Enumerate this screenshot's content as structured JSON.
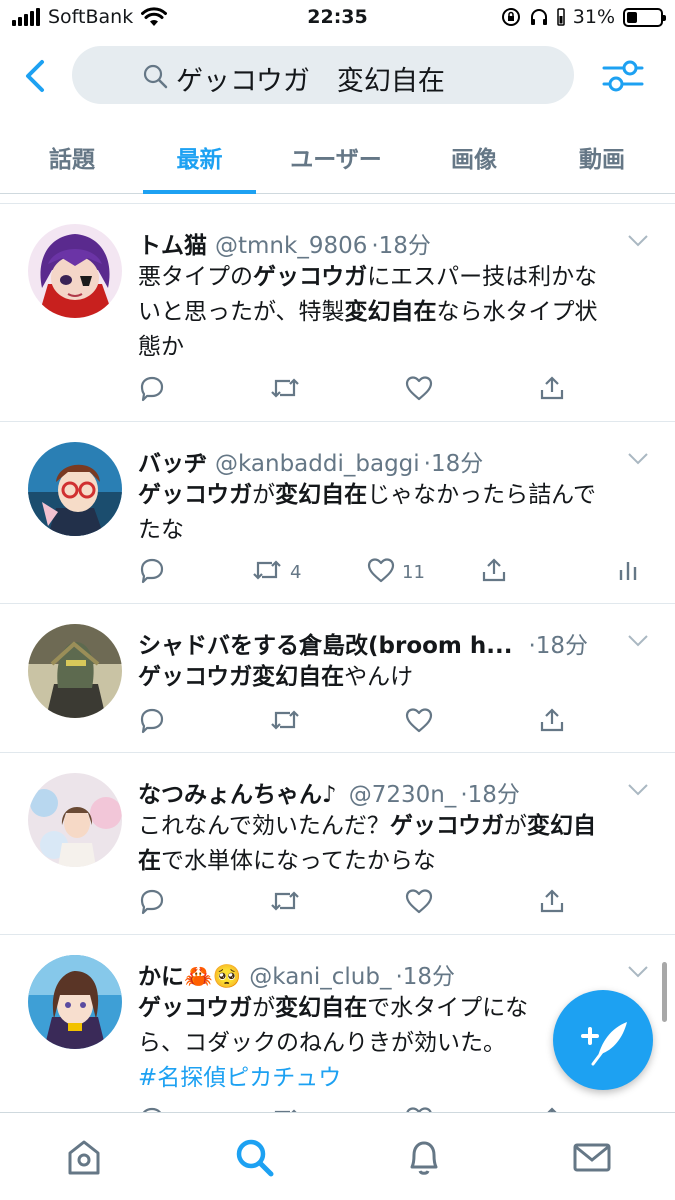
{
  "status_bar": {
    "carrier": "SoftBank",
    "time": "22:35",
    "battery": "31%"
  },
  "search": {
    "query": "ゲッコウガ　変幻自在"
  },
  "tabs": [
    {
      "label": "話題",
      "active": false
    },
    {
      "label": "最新",
      "active": true
    },
    {
      "label": "ユーザー",
      "active": false
    },
    {
      "label": "画像",
      "active": false
    },
    {
      "label": "動画",
      "active": false
    }
  ],
  "tweets": [
    {
      "name": "トム猫",
      "handle": "@tmnk_9806",
      "time": "·18分",
      "lines": [
        [
          {
            "t": "悪タイプの"
          },
          {
            "t": "ゲッコウガ",
            "b": true
          },
          {
            "t": "にエスパー技は利かな"
          }
        ],
        [
          {
            "t": "いと思ったが、特製"
          },
          {
            "t": "変幻自在",
            "b": true
          },
          {
            "t": "なら水タイプ状"
          }
        ],
        [
          {
            "t": "態か"
          }
        ]
      ],
      "retweets": "",
      "likes": ""
    },
    {
      "name": "バッヂ",
      "handle": "@kanbaddi_baggi",
      "time": "·18分",
      "lines": [
        [
          {
            "t": "ゲッコウガ",
            "b": true
          },
          {
            "t": "が"
          },
          {
            "t": "変幻自在",
            "b": true
          },
          {
            "t": "じゃなかったら詰んで"
          }
        ],
        [
          {
            "t": "たな"
          }
        ]
      ],
      "retweets": "4",
      "likes": "11"
    },
    {
      "name": "シャドバをする倉島改(broom h...",
      "handle": "",
      "time": "·18分",
      "lines": [
        [
          {
            "t": "ゲッコウガ変幻自在",
            "b": true
          },
          {
            "t": "やんけ"
          }
        ]
      ],
      "retweets": "",
      "likes": ""
    },
    {
      "name": "なつみょんちゃん♪",
      "handle": "@7230n_",
      "time": "·18分",
      "lines": [
        [
          {
            "t": "これなんで効いたんだ？"
          },
          {
            "t": "ゲッコウガ",
            "b": true
          },
          {
            "t": "が"
          },
          {
            "t": "変幻自",
            "b": true
          }
        ],
        [
          {
            "t": "在",
            "b": true
          },
          {
            "t": "で水単体になってたからな"
          }
        ]
      ],
      "retweets": "",
      "likes": ""
    },
    {
      "name": "かに🦀🥺",
      "handle": "@kani_club_",
      "time": "·18分",
      "lines": [
        [
          {
            "t": "ゲッコウガ",
            "b": true
          },
          {
            "t": "が"
          },
          {
            "t": "変幻自在",
            "b": true
          },
          {
            "t": "で水タイプにな"
          }
        ],
        [
          {
            "t": "ら、コダックのねんりきが効いた。"
          }
        ],
        [
          {
            "t": "#名探偵ピカチュウ",
            "h": true
          }
        ]
      ],
      "retweets": "",
      "likes": ""
    }
  ],
  "bottom_nav": [
    {
      "icon": "home-icon"
    },
    {
      "icon": "search-icon"
    },
    {
      "icon": "bell-icon"
    },
    {
      "icon": "mail-icon"
    }
  ],
  "colors": {
    "accent": "#1da1f2",
    "text": "#14171a",
    "muted": "#657786"
  }
}
